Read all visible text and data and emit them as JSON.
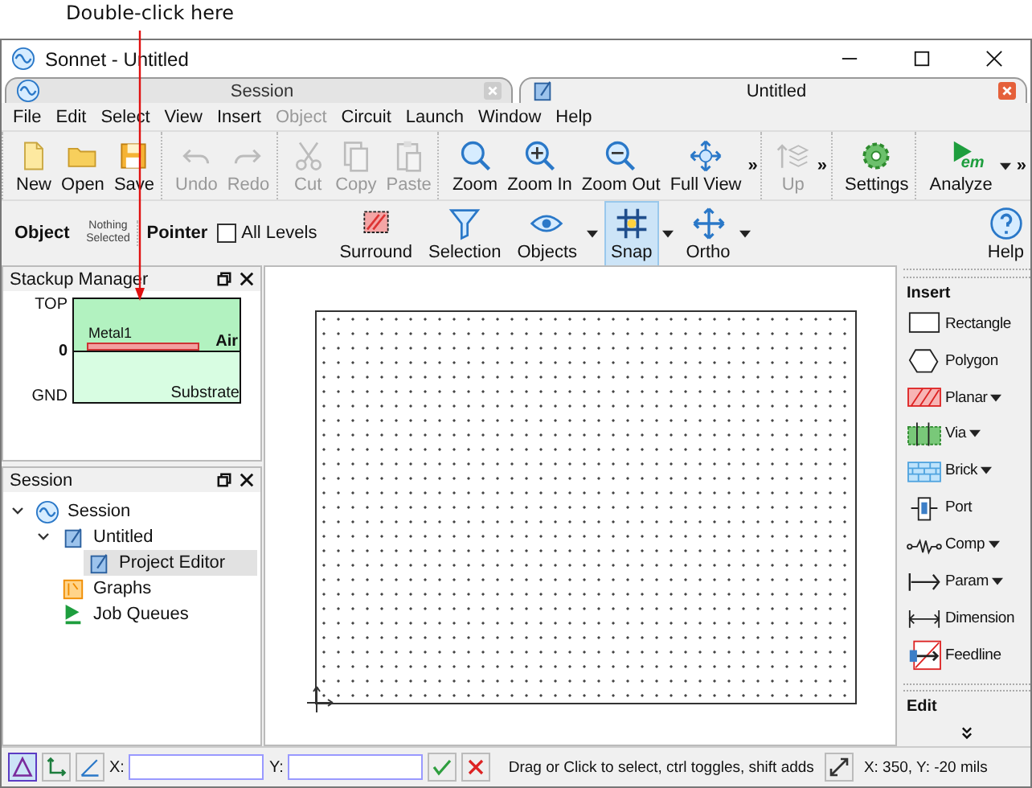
{
  "annotation": {
    "text": "Double-click here"
  },
  "window": {
    "title": "Sonnet - Untitled"
  },
  "doc_tabs": [
    {
      "label": "Session",
      "selected": false
    },
    {
      "label": "Untitled",
      "selected": true
    }
  ],
  "menu": [
    {
      "label": "File",
      "disabled": false
    },
    {
      "label": "Edit",
      "disabled": false
    },
    {
      "label": "Select",
      "disabled": false
    },
    {
      "label": "View",
      "disabled": false
    },
    {
      "label": "Insert",
      "disabled": false
    },
    {
      "label": "Object",
      "disabled": true
    },
    {
      "label": "Circuit",
      "disabled": false
    },
    {
      "label": "Launch",
      "disabled": false
    },
    {
      "label": "Window",
      "disabled": false
    },
    {
      "label": "Help",
      "disabled": false
    }
  ],
  "toolbar": [
    {
      "items": [
        {
          "label": "New",
          "disabled": false
        },
        {
          "label": "Open",
          "disabled": false
        },
        {
          "label": "Save",
          "disabled": false
        }
      ]
    },
    {
      "items": [
        {
          "label": "Undo",
          "disabled": true
        },
        {
          "label": "Redo",
          "disabled": true
        }
      ]
    },
    {
      "items": [
        {
          "label": "Cut",
          "disabled": true
        },
        {
          "label": "Copy",
          "disabled": true
        },
        {
          "label": "Paste",
          "disabled": true
        }
      ]
    },
    {
      "items": [
        {
          "label": "Zoom",
          "disabled": false
        },
        {
          "label": "Zoom In",
          "disabled": false
        },
        {
          "label": "Zoom Out",
          "disabled": false
        },
        {
          "label": "Full View",
          "disabled": false
        }
      ],
      "overflow": "»"
    },
    {
      "items": [
        {
          "label": "Up",
          "disabled": true
        }
      ],
      "overflow": "»"
    },
    {
      "items": [
        {
          "label": "Settings",
          "disabled": false
        }
      ]
    },
    {
      "items": [
        {
          "label": "Analyze",
          "disabled": false,
          "icon_text": "em",
          "dropdown": true
        }
      ],
      "overflow": "»"
    }
  ],
  "toolbar2": [
    {
      "kind": "heading",
      "label": "Object"
    },
    {
      "kind": "note",
      "label": "Nothing Selected"
    },
    {
      "kind": "heading",
      "label": "Pointer"
    },
    {
      "kind": "checkbox",
      "label": "All Levels",
      "checked": false
    },
    {
      "kind": "tool",
      "label": "Surround",
      "dropdown": false,
      "selected": false
    },
    {
      "kind": "tool",
      "label": "Selection",
      "dropdown": false,
      "selected": false
    },
    {
      "kind": "tool",
      "label": "Objects",
      "dropdown": true,
      "selected": false
    },
    {
      "kind": "tool",
      "label": "Snap",
      "dropdown": true,
      "selected": true
    },
    {
      "kind": "tool",
      "label": "Ortho",
      "dropdown": true,
      "selected": false
    },
    {
      "kind": "help",
      "label": "Help"
    }
  ],
  "stackup": {
    "title": "Stackup Manager",
    "top": "TOP",
    "zero": "0",
    "gnd": "GND",
    "metal": "Metal1",
    "air": "Air",
    "substrate": "Substrate"
  },
  "session_panel": {
    "title": "Session",
    "tree": [
      {
        "label": "Session",
        "expanded": true,
        "selected": false,
        "children": [
          {
            "label": "Untitled",
            "expanded": true,
            "selected": false,
            "children": [
              {
                "label": "Project Editor",
                "selected": true
              }
            ]
          },
          {
            "label": "Graphs",
            "selected": false
          },
          {
            "label": "Job Queues",
            "selected": false
          }
        ]
      }
    ]
  },
  "insert_panel": {
    "title": "Insert",
    "items": [
      {
        "label": "Rectangle",
        "dropdown": false
      },
      {
        "label": "Polygon",
        "dropdown": false
      },
      {
        "label": "Planar",
        "dropdown": true
      },
      {
        "label": "Via",
        "dropdown": true
      },
      {
        "label": "Brick",
        "dropdown": true
      },
      {
        "label": "Port",
        "dropdown": false
      },
      {
        "label": "Comp",
        "dropdown": true
      },
      {
        "label": "Param",
        "dropdown": true
      },
      {
        "label": "Dimension",
        "dropdown": false
      },
      {
        "label": "Feedline",
        "dropdown": false
      }
    ],
    "edit_title": "Edit"
  },
  "status_bar": {
    "modes": [
      {
        "selected": true
      },
      {
        "selected": false
      },
      {
        "selected": false
      }
    ],
    "x_label": "X:",
    "y_label": "Y:",
    "message": "Drag or Click to select, ctrl toggles, shift adds",
    "coordinates": "X: 350, Y: -20 mils"
  }
}
